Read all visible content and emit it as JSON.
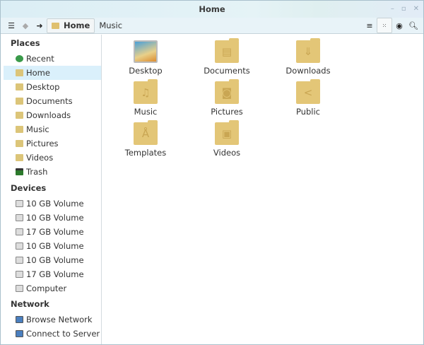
{
  "window": {
    "title": "Home",
    "controls": [
      "–",
      "▫",
      "✕"
    ]
  },
  "toolbar": {
    "crumbs": [
      "Home",
      "Music"
    ]
  },
  "sidebar": {
    "places_header": "Places",
    "places": [
      {
        "label": "Recent",
        "icon": "recent"
      },
      {
        "label": "Home",
        "icon": "folder"
      },
      {
        "label": "Desktop",
        "icon": "folder"
      },
      {
        "label": "Documents",
        "icon": "folder"
      },
      {
        "label": "Downloads",
        "icon": "folder"
      },
      {
        "label": "Music",
        "icon": "folder"
      },
      {
        "label": "Pictures",
        "icon": "folder"
      },
      {
        "label": "Videos",
        "icon": "folder"
      },
      {
        "label": "Trash",
        "icon": "trash"
      }
    ],
    "devices_header": "Devices",
    "devices": [
      "10 GB Volume",
      "10 GB Volume",
      "17 GB Volume",
      "10 GB Volume",
      "10 GB Volume",
      "17 GB Volume",
      "Computer"
    ],
    "network_header": "Network",
    "network": [
      "Browse Network",
      "Connect to Server"
    ]
  },
  "files": [
    {
      "name": "Desktop",
      "glyph": ""
    },
    {
      "name": "Documents",
      "glyph": "▤"
    },
    {
      "name": "Downloads",
      "glyph": "⇓"
    },
    {
      "name": "Music",
      "glyph": "♫"
    },
    {
      "name": "Pictures",
      "glyph": "◙"
    },
    {
      "name": "Public",
      "glyph": "<"
    },
    {
      "name": "Templates",
      "glyph": "Å"
    },
    {
      "name": "Videos",
      "glyph": "▣"
    }
  ]
}
